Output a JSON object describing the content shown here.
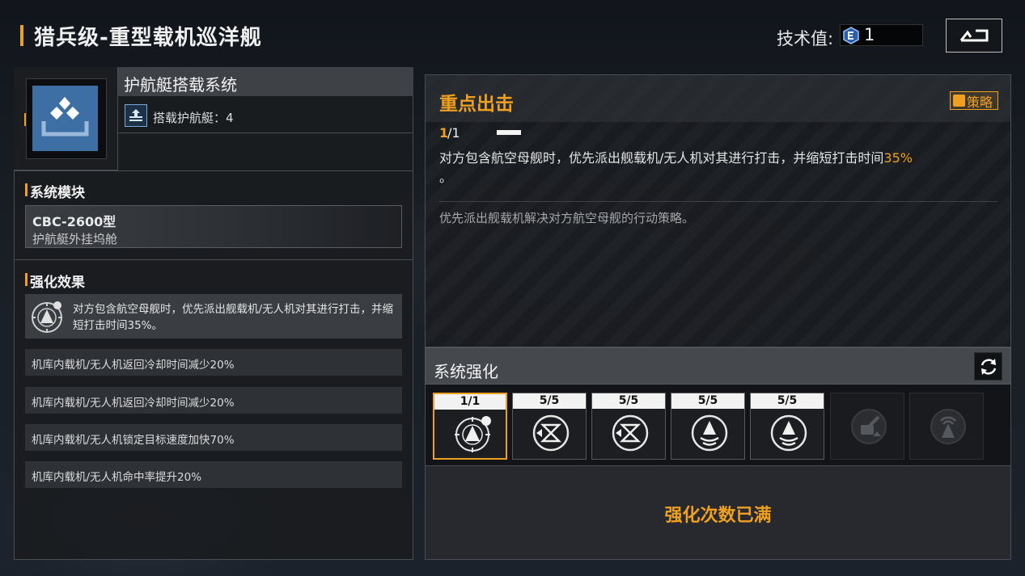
{
  "header": {
    "title": "猎兵级-重型载机巡洋舰",
    "tech_label": "技术值:",
    "tech_value": "1",
    "back_icon": "return-arrow-icon"
  },
  "system": {
    "name": "护航艇搭载系统",
    "icon": "carrier-stack-icon",
    "icon_color": "#3d6fa5",
    "carrier_label": "搭载护航艇：4"
  },
  "module": {
    "section_title": "系统模块",
    "code": "CBC-2600型",
    "desc": "护航艇外挂坞舱"
  },
  "effects": {
    "section_title": "强化效果",
    "main_text": "对方包含航空母舰时，优先派出舰载机/无人机对其进行打击，并缩短打击时间35%。",
    "items": [
      "机库内载机/无人机返回冷却时间减少20%",
      "机库内载机/无人机返回冷却时间减少20%",
      "机库内载机/无人机锁定目标速度加快70%",
      "机库内载机/无人机命中率提升20%"
    ]
  },
  "strategy": {
    "title": "重点出击",
    "tag": "策略",
    "count_current": "1",
    "count_total": "/1",
    "desc_main": "对方包含航空母舰时，优先派出舰载机/无人机对其进行打击，并缩短打击时间",
    "desc_highlight": "35%",
    "desc_tail": "。",
    "note": "优先派出舰载机解决对方航空母舰的行动策略。"
  },
  "enhance": {
    "title": "系统强化",
    "refresh_icon": "refresh-icon",
    "slots": [
      {
        "count": "1/1",
        "icon": "strike-priority-icon",
        "selected": true
      },
      {
        "count": "5/5",
        "icon": "cooldown-icon"
      },
      {
        "count": "5/5",
        "icon": "cooldown-icon"
      },
      {
        "count": "5/5",
        "icon": "lock-speed-icon"
      },
      {
        "count": "5/5",
        "icon": "hit-rate-icon"
      },
      {
        "icon": "locked-turret-icon",
        "locked": true
      },
      {
        "icon": "locked-radar-icon",
        "locked": true
      }
    ],
    "status": "强化次数已满"
  },
  "colors": {
    "accent": "#f0a020",
    "panel_border": "#4a4d52"
  }
}
